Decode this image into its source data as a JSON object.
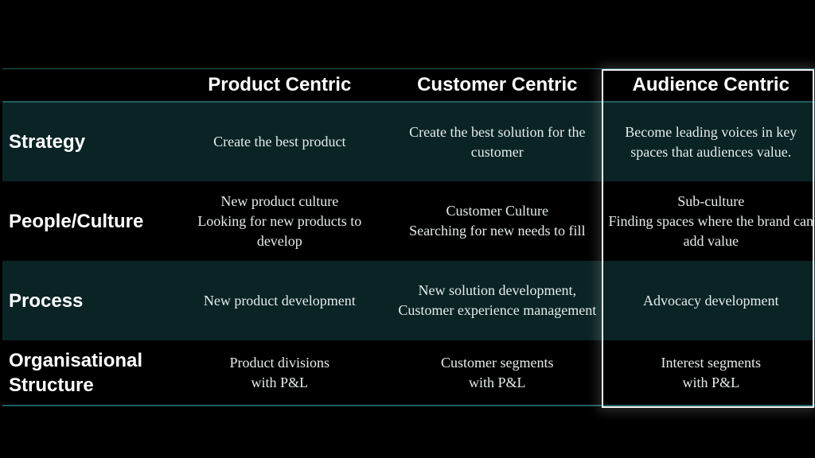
{
  "table": {
    "columns": [
      "Product Centric",
      "Customer Centric",
      "Audience Centric"
    ],
    "highlighted_column": "Audience Centric",
    "rows": [
      {
        "label": "Strategy",
        "cells": [
          "Create the best product",
          "Create the best solution for the customer",
          "Become leading voices in key spaces that audiences value."
        ]
      },
      {
        "label": "People/Culture",
        "cells": [
          "New product culture\nLooking for new products to develop",
          "Customer Culture\nSearching for new needs to fill",
          "Sub-culture\nFinding spaces where the brand can add value"
        ]
      },
      {
        "label": "Process",
        "cells": [
          "New product development",
          "New solution development, Customer experience management",
          "Advocacy development"
        ]
      },
      {
        "label": "Organisational Structure",
        "cells": [
          "Product divisions\nwith P&L",
          "Customer segments\nwith P&L",
          "Interest segments\nwith P&L"
        ]
      }
    ]
  },
  "colors": {
    "background": "#000000",
    "row_band": "#0a2426",
    "rule": "#1f5e60",
    "highlight_border": "#f2f2f2"
  }
}
